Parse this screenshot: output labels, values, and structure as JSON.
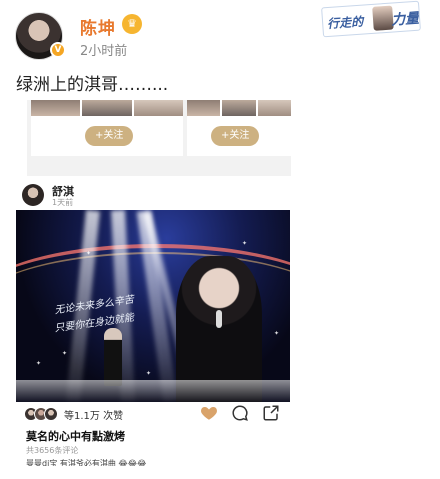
{
  "post": {
    "author": "陈坤",
    "time": "2小时前",
    "text": "绿洲上的淇哥……...",
    "verified_badge": "V",
    "crown": "♛"
  },
  "topic_tag": {
    "text_left": "行走的",
    "text_right": "力量"
  },
  "cards": [
    {
      "follow_label": "+关注"
    },
    {
      "follow_label": "+关注"
    }
  ],
  "repost": {
    "author": "舒淇",
    "time": "1天前",
    "photo_lyrics": [
      "无论未来多么辛苦",
      "只要你在身边就能"
    ],
    "likes_text": "等1.1万 次赞",
    "caption": "莫名的心中有點激烤",
    "comment_count": "共3656条评论",
    "partial_comment": "曼曼di宝  有淇爷必有淇曲 😂😂😂"
  },
  "colors": {
    "author_name": "#e8792e",
    "follow_button": "#cdb181",
    "heart": "#d9a36a",
    "time_gray": "#888888"
  },
  "icons": [
    "crown-icon",
    "heart-icon",
    "comment-icon",
    "share-icon"
  ]
}
